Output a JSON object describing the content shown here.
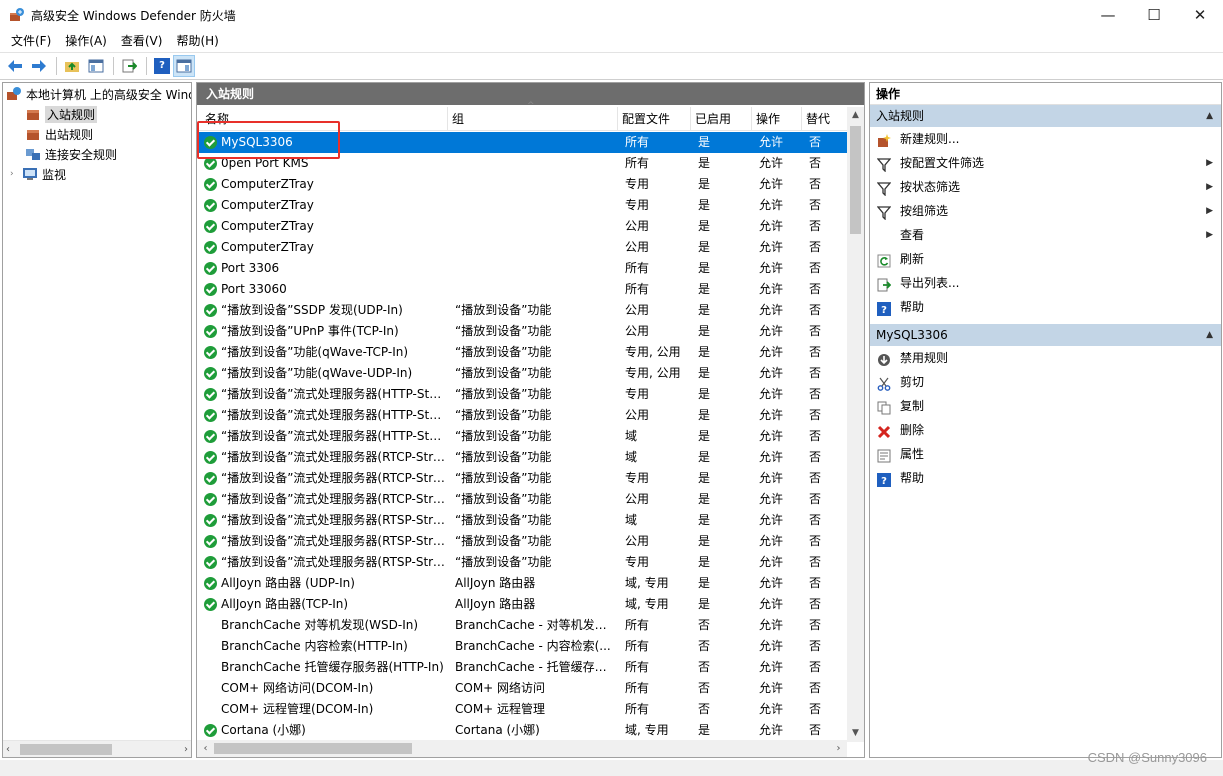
{
  "window": {
    "title": "高级安全 Windows Defender 防火墙",
    "minimize": "—",
    "maximize": "☐",
    "close": "✕"
  },
  "menu": [
    "文件(F)",
    "操作(A)",
    "查看(V)",
    "帮助(H)"
  ],
  "tree": {
    "root": "本地计算机 上的高级安全 Windows Defender 防火墙",
    "items": [
      "入站规则",
      "出站规则",
      "连接安全规则",
      "监视"
    ]
  },
  "center": {
    "header": "入站规则",
    "columns": [
      "名称",
      "组",
      "配置文件",
      "已启用",
      "操作",
      "替代"
    ],
    "rows": [
      {
        "name": "MySQL3306",
        "group": "",
        "profile": "所有",
        "enabled": "是",
        "action": "允许",
        "override": "否",
        "check": true
      },
      {
        "name": "0pen Port KMS",
        "group": "",
        "profile": "所有",
        "enabled": "是",
        "action": "允许",
        "override": "否",
        "check": true
      },
      {
        "name": "ComputerZTray",
        "group": "",
        "profile": "专用",
        "enabled": "是",
        "action": "允许",
        "override": "否",
        "check": true
      },
      {
        "name": "ComputerZTray",
        "group": "",
        "profile": "专用",
        "enabled": "是",
        "action": "允许",
        "override": "否",
        "check": true
      },
      {
        "name": "ComputerZTray",
        "group": "",
        "profile": "公用",
        "enabled": "是",
        "action": "允许",
        "override": "否",
        "check": true
      },
      {
        "name": "ComputerZTray",
        "group": "",
        "profile": "公用",
        "enabled": "是",
        "action": "允许",
        "override": "否",
        "check": true
      },
      {
        "name": "Port 3306",
        "group": "",
        "profile": "所有",
        "enabled": "是",
        "action": "允许",
        "override": "否",
        "check": true
      },
      {
        "name": "Port 33060",
        "group": "",
        "profile": "所有",
        "enabled": "是",
        "action": "允许",
        "override": "否",
        "check": true
      },
      {
        "name": "“播放到设备”SSDP 发现(UDP-In)",
        "group": "“播放到设备”功能",
        "profile": "公用",
        "enabled": "是",
        "action": "允许",
        "override": "否",
        "check": true
      },
      {
        "name": "“播放到设备”UPnP 事件(TCP-In)",
        "group": "“播放到设备”功能",
        "profile": "公用",
        "enabled": "是",
        "action": "允许",
        "override": "否",
        "check": true
      },
      {
        "name": "“播放到设备”功能(qWave-TCP-In)",
        "group": "“播放到设备”功能",
        "profile": "专用, 公用",
        "enabled": "是",
        "action": "允许",
        "override": "否",
        "check": true
      },
      {
        "name": "“播放到设备”功能(qWave-UDP-In)",
        "group": "“播放到设备”功能",
        "profile": "专用, 公用",
        "enabled": "是",
        "action": "允许",
        "override": "否",
        "check": true
      },
      {
        "name": "“播放到设备”流式处理服务器(HTTP-Stre...",
        "group": "“播放到设备”功能",
        "profile": "专用",
        "enabled": "是",
        "action": "允许",
        "override": "否",
        "check": true
      },
      {
        "name": "“播放到设备”流式处理服务器(HTTP-Stre...",
        "group": "“播放到设备”功能",
        "profile": "公用",
        "enabled": "是",
        "action": "允许",
        "override": "否",
        "check": true
      },
      {
        "name": "“播放到设备”流式处理服务器(HTTP-Stre...",
        "group": "“播放到设备”功能",
        "profile": "域",
        "enabled": "是",
        "action": "允许",
        "override": "否",
        "check": true
      },
      {
        "name": "“播放到设备”流式处理服务器(RTCP-Stre...",
        "group": "“播放到设备”功能",
        "profile": "域",
        "enabled": "是",
        "action": "允许",
        "override": "否",
        "check": true
      },
      {
        "name": "“播放到设备”流式处理服务器(RTCP-Stre...",
        "group": "“播放到设备”功能",
        "profile": "专用",
        "enabled": "是",
        "action": "允许",
        "override": "否",
        "check": true
      },
      {
        "name": "“播放到设备”流式处理服务器(RTCP-Stre...",
        "group": "“播放到设备”功能",
        "profile": "公用",
        "enabled": "是",
        "action": "允许",
        "override": "否",
        "check": true
      },
      {
        "name": "“播放到设备”流式处理服务器(RTSP-Stre...",
        "group": "“播放到设备”功能",
        "profile": "域",
        "enabled": "是",
        "action": "允许",
        "override": "否",
        "check": true
      },
      {
        "name": "“播放到设备”流式处理服务器(RTSP-Stre...",
        "group": "“播放到设备”功能",
        "profile": "公用",
        "enabled": "是",
        "action": "允许",
        "override": "否",
        "check": true
      },
      {
        "name": "“播放到设备”流式处理服务器(RTSP-Stre...",
        "group": "“播放到设备”功能",
        "profile": "专用",
        "enabled": "是",
        "action": "允许",
        "override": "否",
        "check": true
      },
      {
        "name": "AllJoyn 路由器 (UDP-In)",
        "group": "AllJoyn 路由器",
        "profile": "域, 专用",
        "enabled": "是",
        "action": "允许",
        "override": "否",
        "check": true
      },
      {
        "name": "AllJoyn 路由器(TCP-In)",
        "group": "AllJoyn 路由器",
        "profile": "域, 专用",
        "enabled": "是",
        "action": "允许",
        "override": "否",
        "check": true
      },
      {
        "name": "BranchCache 对等机发现(WSD-In)",
        "group": "BranchCache - 对等机发现...",
        "profile": "所有",
        "enabled": "否",
        "action": "允许",
        "override": "否",
        "check": false
      },
      {
        "name": "BranchCache 内容检索(HTTP-In)",
        "group": "BranchCache - 内容检索(...",
        "profile": "所有",
        "enabled": "否",
        "action": "允许",
        "override": "否",
        "check": false
      },
      {
        "name": "BranchCache 托管缓存服务器(HTTP-In)",
        "group": "BranchCache - 托管缓存服...",
        "profile": "所有",
        "enabled": "否",
        "action": "允许",
        "override": "否",
        "check": false
      },
      {
        "name": "COM+ 网络访问(DCOM-In)",
        "group": "COM+ 网络访问",
        "profile": "所有",
        "enabled": "否",
        "action": "允许",
        "override": "否",
        "check": false
      },
      {
        "name": "COM+ 远程管理(DCOM-In)",
        "group": "COM+ 远程管理",
        "profile": "所有",
        "enabled": "否",
        "action": "允许",
        "override": "否",
        "check": false
      },
      {
        "name": "Cortana (小娜)",
        "group": "Cortana (小娜)",
        "profile": "域, 专用",
        "enabled": "是",
        "action": "允许",
        "override": "否",
        "check": true
      }
    ]
  },
  "actions": {
    "header": "操作",
    "section1": {
      "title": "入站规则",
      "items": [
        {
          "label": "新建规则...",
          "icon": "new-rule-icon",
          "submenu": false
        },
        {
          "label": "按配置文件筛选",
          "icon": "filter-icon",
          "submenu": true
        },
        {
          "label": "按状态筛选",
          "icon": "filter-icon",
          "submenu": true
        },
        {
          "label": "按组筛选",
          "icon": "filter-icon",
          "submenu": true
        },
        {
          "label": "查看",
          "icon": "",
          "submenu": true
        },
        {
          "label": "刷新",
          "icon": "refresh-icon",
          "submenu": false
        },
        {
          "label": "导出列表...",
          "icon": "export-icon",
          "submenu": false
        },
        {
          "label": "帮助",
          "icon": "help-icon",
          "submenu": false
        }
      ]
    },
    "section2": {
      "title": "MySQL3306",
      "items": [
        {
          "label": "禁用规则",
          "icon": "disable-icon"
        },
        {
          "label": "剪切",
          "icon": "cut-icon"
        },
        {
          "label": "复制",
          "icon": "copy-icon"
        },
        {
          "label": "删除",
          "icon": "delete-icon"
        },
        {
          "label": "属性",
          "icon": "properties-icon"
        },
        {
          "label": "帮助",
          "icon": "help-icon"
        }
      ]
    }
  },
  "watermark": "CSDN @Sunny3096",
  "colors": {
    "selection": "#0078d7",
    "highlight": "#e8302a",
    "band": "#c3d5e6",
    "header": "#6d6d6d"
  }
}
